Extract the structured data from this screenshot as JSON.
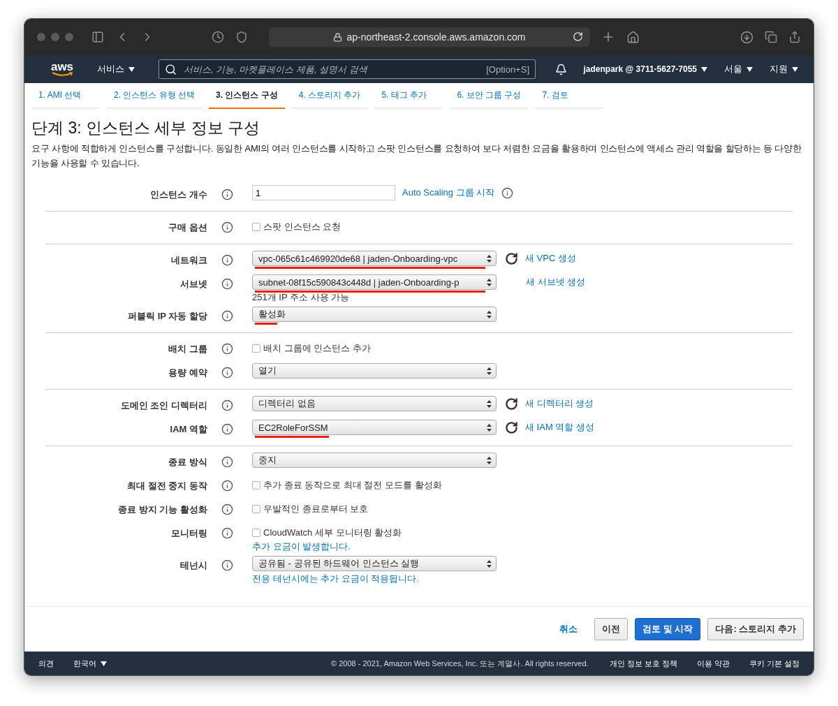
{
  "browser": {
    "url": "ap-northeast-2.console.aws.amazon.com"
  },
  "nav": {
    "logo": "aws",
    "services": "서비스",
    "search_placeholder": "서비스, 기능, 마켓플레이스 제품, 설명서 검색",
    "shortcut": "[Option+S]",
    "account": "jadenpark @ 3711-5627-7055",
    "region": "서울",
    "support": "지원"
  },
  "steps": [
    {
      "label": "1. AMI 선택",
      "selected": false
    },
    {
      "label": "2. 인스턴스 유형 선택",
      "selected": false
    },
    {
      "label": "3. 인스턴스 구성",
      "selected": true
    },
    {
      "label": "4. 스토리지 추가",
      "selected": false
    },
    {
      "label": "5. 태그 추가",
      "selected": false
    },
    {
      "label": "6. 보안 그룹 구성",
      "selected": false
    },
    {
      "label": "7. 검토",
      "selected": false
    }
  ],
  "heading": "단계 3: 인스턴스 세부 정보 구성",
  "description": "요구 사항에 적합하게 인스턴스를 구성합니다. 동일한 AMI의 여러 인스턴스를 시작하고 스팟 인스턴스를 요청하여 보다 저렴한 요금을 활용하며 인스턴스에 액세스 관리 역할을 할당하는 등 다양한 기능을 사용할 수 있습니다.",
  "sections": [
    {
      "rows": [
        {
          "label": "인스턴스 개수",
          "kind": "number",
          "value": "1",
          "link": "Auto Scaling 그룹 시작",
          "link_info": true
        }
      ]
    },
    {
      "rows": [
        {
          "label": "구매 옵션",
          "kind": "checkbox",
          "value": "스팟 인스턴스 요청",
          "checked": false
        }
      ]
    },
    {
      "rows": [
        {
          "label": "네트워크",
          "kind": "select",
          "value": "vpc-065c61c469920de68 | jaden-Onboarding-vpc",
          "highlighted": true,
          "refresh": true,
          "link": "새 VPC 생성"
        },
        {
          "label": "서브넷",
          "kind": "select",
          "value": "subnet-08f15c590843c448d | jaden-Onboarding-p",
          "highlighted": true,
          "link": "새 서브넷 생성",
          "note": {
            "text": "251개 IP 주소 사용 가능",
            "kind": "plain"
          }
        },
        {
          "label": "퍼블릭 IP 자동 할당",
          "kind": "select",
          "value": "활성화",
          "highlighted": true
        }
      ]
    },
    {
      "rows": [
        {
          "label": "배치 그룹",
          "kind": "checkbox",
          "value": "배치 그룹에 인스턴스 추가",
          "checked": false
        },
        {
          "label": "용량 예약",
          "kind": "select",
          "value": "열기"
        }
      ]
    },
    {
      "rows": [
        {
          "label": "도메인 조인 디렉터리",
          "kind": "select",
          "value": "디렉터리 없음",
          "refresh": true,
          "link": "새 디렉터리 생성"
        },
        {
          "label": "IAM 역할",
          "kind": "select",
          "value": "EC2RoleForSSM",
          "highlighted": true,
          "refresh": true,
          "link": "새 IAM 역할 생성"
        }
      ]
    },
    {
      "rows": [
        {
          "label": "종료 방식",
          "kind": "select",
          "value": "중지"
        },
        {
          "label": "최대 절전 중지 동작",
          "kind": "checkbox",
          "value": "추가 종료 동작으로 최대 절전 모드를 활성화",
          "checked": false
        },
        {
          "label": "종료 방지 기능 활성화",
          "kind": "checkbox",
          "value": "우발적인 종료로부터 보호",
          "checked": false
        },
        {
          "label": "모니터링",
          "kind": "checkbox",
          "value": "CloudWatch 세부 모니터링 활성화",
          "checked": false,
          "note": {
            "text": "추가 요금이 발생합니다.",
            "kind": "link"
          }
        },
        {
          "label": "테넌시",
          "kind": "select",
          "value": "공유됨 - 공유된 하드웨어 인스턴스 실행",
          "note": {
            "text": "전용 테넌시에는 추가 요금이 적용됩니다.",
            "kind": "link"
          }
        }
      ]
    }
  ],
  "actions": [
    {
      "label": "취소",
      "kind": "link"
    },
    {
      "label": "이전",
      "kind": "secondary"
    },
    {
      "label": "검토 및 시작",
      "kind": "primary"
    },
    {
      "label": "다음: 스토리지 추가",
      "kind": "secondary"
    }
  ],
  "footer": {
    "feedback": "의견",
    "language": "한국어",
    "copyright": "© 2008 - 2021, Amazon Web Services, Inc. 또는 계열사. All rights reserved.",
    "links": [
      "개인 정보 보호 정책",
      "이용 약관",
      "쿠키 기본 설정"
    ]
  }
}
